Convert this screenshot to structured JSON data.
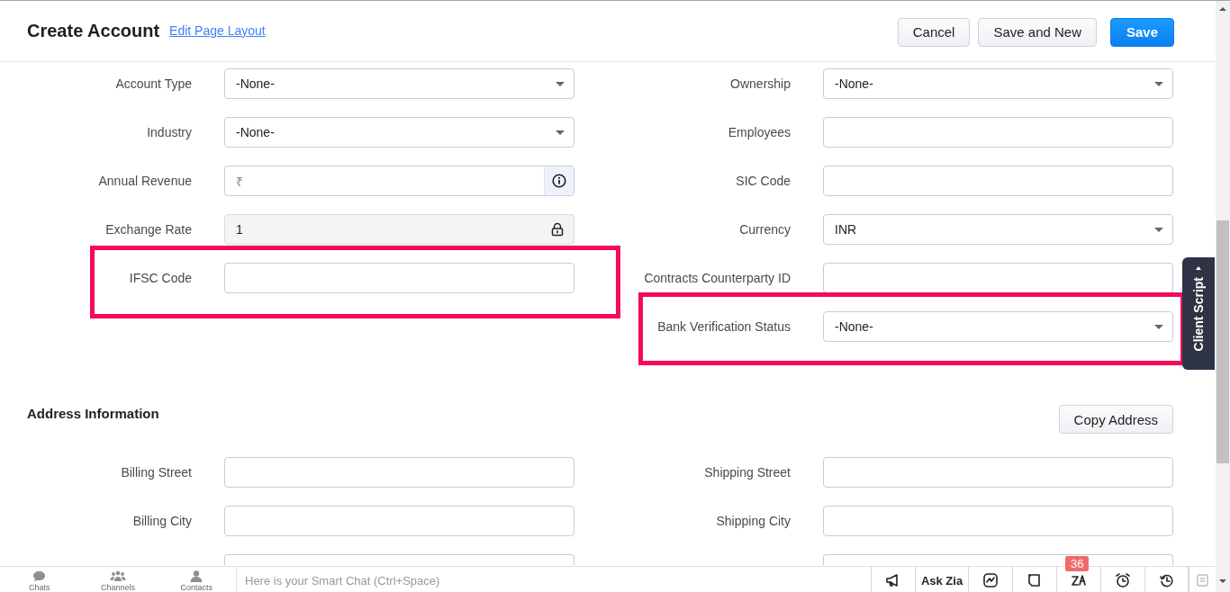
{
  "header": {
    "title": "Create Account",
    "link": "Edit Page Layout",
    "buttons": [
      {
        "label": "Cancel",
        "kind": "secondary"
      },
      {
        "label": "Save and New",
        "kind": "secondary"
      },
      {
        "label": "Save",
        "kind": "primary"
      }
    ]
  },
  "sections": [
    {
      "rows": [
        {
          "left": {
            "label": "Account Type",
            "kind": "select",
            "value": "-None-",
            "highlighted": false
          },
          "right": {
            "label": "Ownership",
            "kind": "select",
            "value": "-None-",
            "highlighted": false
          }
        },
        {
          "left": {
            "label": "Industry",
            "kind": "select",
            "value": "-None-",
            "highlighted": false
          },
          "right": {
            "label": "Employees",
            "kind": "text",
            "highlighted": false
          }
        },
        {
          "left": {
            "label": "Annual Revenue",
            "kind": "currency",
            "prefix": "₹",
            "highlighted": false
          },
          "right": {
            "label": "SIC Code",
            "kind": "text",
            "highlighted": false
          }
        },
        {
          "left": {
            "label": "Exchange Rate",
            "kind": "locked",
            "value": "1",
            "highlighted": false
          },
          "right": {
            "label": "Currency",
            "kind": "select",
            "value": "INR",
            "highlighted": false
          }
        },
        {
          "left": {
            "label": "IFSC Code",
            "kind": "text",
            "highlighted": true
          },
          "right": {
            "label": "Contracts Counterparty ID",
            "kind": "text",
            "highlighted": false
          }
        },
        {
          "right": {
            "label": "Bank Verification Status",
            "kind": "select",
            "value": "-None-",
            "highlighted": true
          }
        }
      ]
    },
    {
      "title": "Address Information",
      "action": "Copy Address",
      "rows": [
        {
          "left": {
            "label": "Billing Street",
            "kind": "text",
            "highlighted": false
          },
          "right": {
            "label": "Shipping Street",
            "kind": "text",
            "highlighted": false
          }
        },
        {
          "left": {
            "label": "Billing City",
            "kind": "text",
            "highlighted": false
          },
          "right": {
            "label": "Shipping City",
            "kind": "text",
            "highlighted": false
          }
        },
        {
          "left": {
            "kind": "text",
            "highlighted": false
          },
          "right": {
            "kind": "text",
            "highlighted": false
          }
        }
      ]
    }
  ],
  "side_tab": {
    "label": "Client Script"
  },
  "chat_bar": {
    "tabs": [
      {
        "label": "Chats"
      },
      {
        "label": "Channels"
      },
      {
        "label": "Contacts"
      }
    ],
    "input": {
      "placeholder": "Here is your Smart Chat (Ctrl+Space)"
    },
    "tools": [
      {
        "kind": "icon"
      },
      {
        "kind": "text",
        "label": "Ask Zia"
      },
      {
        "kind": "icon"
      },
      {
        "kind": "icon"
      },
      {
        "kind": "icon",
        "badge": "36"
      },
      {
        "kind": "icon"
      },
      {
        "kind": "icon"
      },
      {
        "kind": "faded"
      }
    ]
  }
}
